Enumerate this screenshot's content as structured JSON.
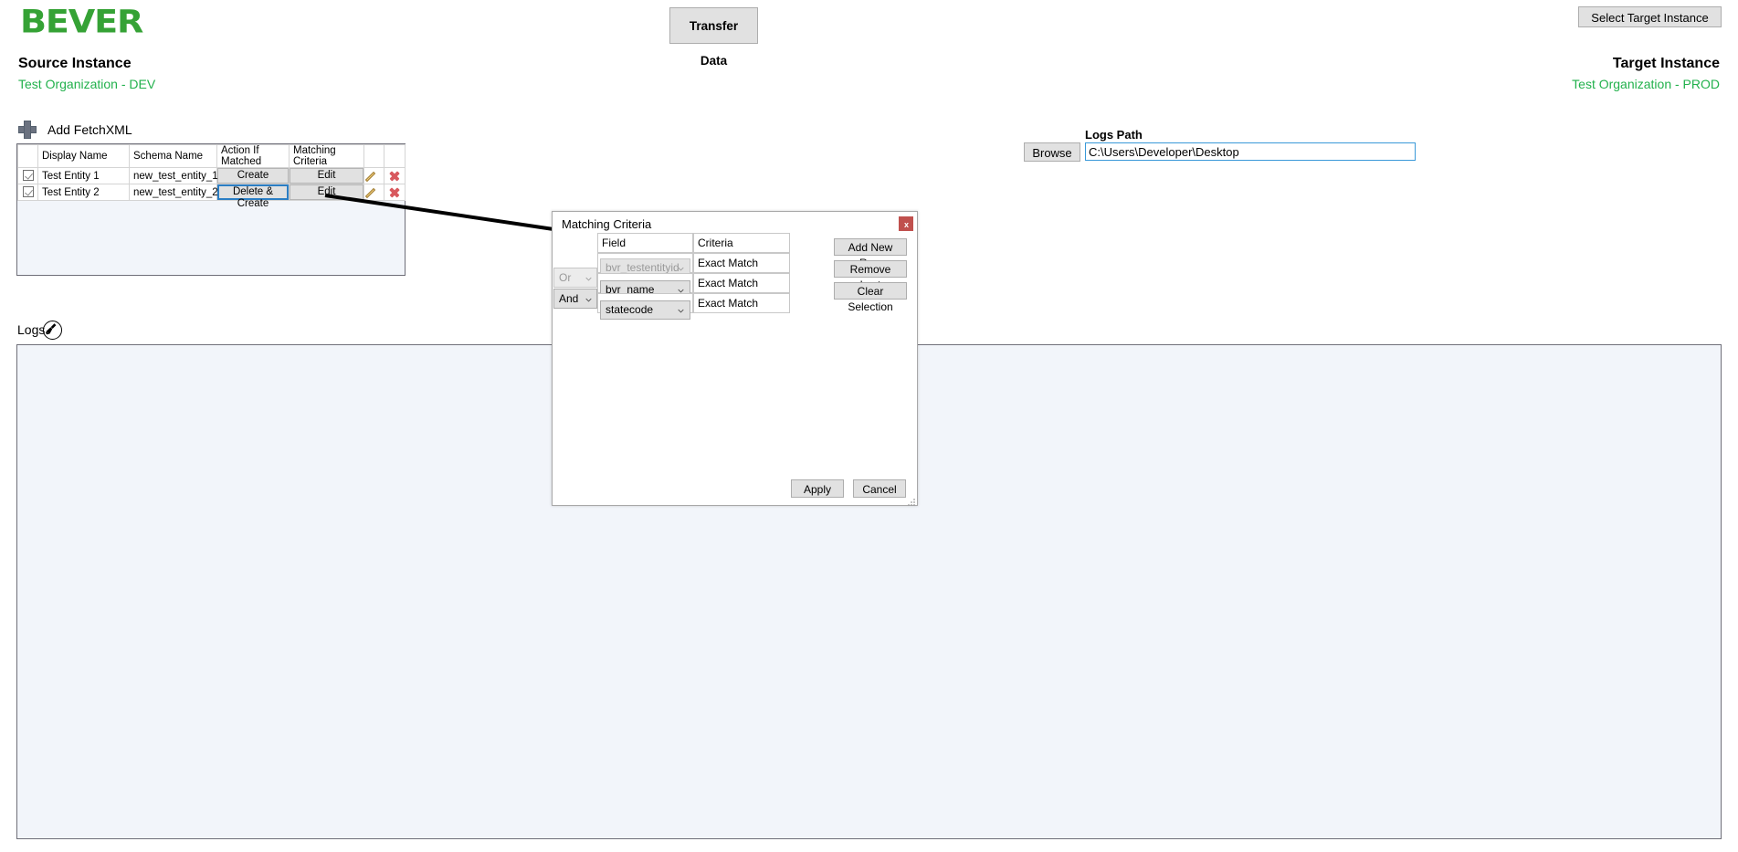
{
  "app": {
    "logo_text": "BEVER"
  },
  "toolbar": {
    "transfer_data_label": "Transfer Data",
    "select_target_instance_label": "Select Target Instance"
  },
  "instances": {
    "source_title": "Source Instance",
    "source_name": "Test Organization - DEV",
    "target_title": "Target Instance",
    "target_name": "Test Organization - PROD",
    "accent_green": "#22b14c"
  },
  "fetchxml": {
    "add_label": "Add FetchXML",
    "plus_icon": "plus-icon"
  },
  "entities_grid": {
    "columns": [
      "",
      "Display Name",
      "Schema Name",
      "Action If Matched",
      "Matching Criteria",
      "",
      ""
    ],
    "rows": [
      {
        "checked": true,
        "display_name": "Test Entity 1",
        "schema_name": "new_test_entity_1",
        "action_if_matched": "Create",
        "matching_criteria": "Edit",
        "edit_icon": "pencil-icon",
        "delete_icon": "red-x-icon",
        "focused": false
      },
      {
        "checked": true,
        "display_name": "Test Entity 2",
        "schema_name": "new_test_entity_2",
        "action_if_matched": "Delete & Create",
        "matching_criteria": "Edit",
        "edit_icon": "pencil-icon",
        "delete_icon": "red-x-icon",
        "focused": true
      }
    ]
  },
  "logs_path": {
    "label": "Logs Path",
    "browse_label": "Browse",
    "value": "C:\\Users\\Developer\\Desktop",
    "placeholder": ""
  },
  "logs": {
    "label": "Logs",
    "clear_icon": "broom-icon",
    "content": ""
  },
  "matching_criteria_dialog": {
    "title": "Matching Criteria",
    "close_label": "x",
    "columns": [
      "Field",
      "Criteria"
    ],
    "logic_operators": [
      {
        "value": "Or",
        "disabled": true
      },
      {
        "value": "And",
        "disabled": false
      }
    ],
    "rows": [
      {
        "field": "bvr_testentityid",
        "criteria": "Exact Match",
        "disabled": true
      },
      {
        "field": "bvr_name",
        "criteria": "Exact Match",
        "disabled": false
      },
      {
        "field": "statecode",
        "criteria": "Exact Match",
        "disabled": false
      }
    ],
    "side_buttons": [
      "Add New Row",
      "Remove Last",
      "Clear Selection"
    ],
    "apply_label": "Apply",
    "cancel_label": "Cancel"
  }
}
